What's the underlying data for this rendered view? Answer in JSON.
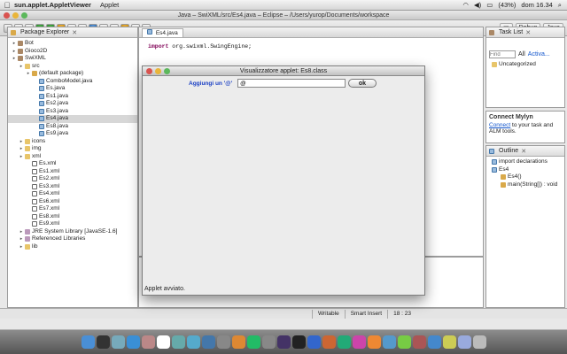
{
  "menubar": {
    "app_name": "sun.applet.AppletViewer",
    "menu": "Applet",
    "battery": "(43%)",
    "clock": "dom 16.34"
  },
  "eclipse": {
    "title": "Java – SwiXML/src/Es4.java – Eclipse – /Users/yurop/Documents/workspace",
    "perspectives": [
      "Debug",
      "Java"
    ]
  },
  "package_explorer": {
    "title": "Package Explorer",
    "items": [
      {
        "label": "Bot",
        "level": 0,
        "icon": "project-icon"
      },
      {
        "label": "Gioco2D",
        "level": 0,
        "icon": "project-icon"
      },
      {
        "label": "SwiXML",
        "level": 0,
        "icon": "project-icon"
      },
      {
        "label": "src",
        "level": 1,
        "icon": "folder-icon"
      },
      {
        "label": "(default package)",
        "level": 2,
        "icon": "package-icon"
      },
      {
        "label": "ComboModel.java",
        "level": 3,
        "icon": "java-file-icon"
      },
      {
        "label": "Es.java",
        "level": 3,
        "icon": "java-file-icon"
      },
      {
        "label": "Es1.java",
        "level": 3,
        "icon": "java-file-icon"
      },
      {
        "label": "Es2.java",
        "level": 3,
        "icon": "java-file-icon"
      },
      {
        "label": "Es3.java",
        "level": 3,
        "icon": "java-file-icon"
      },
      {
        "label": "Es4.java",
        "level": 3,
        "icon": "java-file-icon",
        "selected": true
      },
      {
        "label": "Es8.java",
        "level": 3,
        "icon": "java-file-icon"
      },
      {
        "label": "Es9.java",
        "level": 3,
        "icon": "java-file-icon"
      },
      {
        "label": "icons",
        "level": 1,
        "icon": "folder-icon"
      },
      {
        "label": "img",
        "level": 1,
        "icon": "folder-icon"
      },
      {
        "label": "xml",
        "level": 1,
        "icon": "folder-icon"
      },
      {
        "label": "Es.xml",
        "level": 2,
        "icon": "xml-file-icon"
      },
      {
        "label": "Es1.xml",
        "level": 2,
        "icon": "xml-file-icon"
      },
      {
        "label": "Es2.xml",
        "level": 2,
        "icon": "xml-file-icon"
      },
      {
        "label": "Es3.xml",
        "level": 2,
        "icon": "xml-file-icon"
      },
      {
        "label": "Es4.xml",
        "level": 2,
        "icon": "xml-file-icon"
      },
      {
        "label": "Es6.xml",
        "level": 2,
        "icon": "xml-file-icon"
      },
      {
        "label": "Es7.xml",
        "level": 2,
        "icon": "xml-file-icon"
      },
      {
        "label": "Es8.xml",
        "level": 2,
        "icon": "xml-file-icon"
      },
      {
        "label": "Es9.xml",
        "level": 2,
        "icon": "xml-file-icon"
      },
      {
        "label": "JRE System Library [JavaSE-1.6]",
        "level": 1,
        "icon": "library-icon"
      },
      {
        "label": "Referenced Libraries",
        "level": 1,
        "icon": "library-icon"
      },
      {
        "label": "lib",
        "level": 1,
        "icon": "folder-icon"
      }
    ]
  },
  "editor": {
    "tab": "Es4.java",
    "code_keyword": "import",
    "code_rest": " org.swixml.SwingEngine;"
  },
  "task_list": {
    "title": "Task List",
    "find_placeholder": "Find",
    "filter_all": "All",
    "activate": "Activa...",
    "category": "Uncategorized"
  },
  "mylyn": {
    "title": "Connect Mylyn",
    "link": "Connect",
    "text": " to your task and ALM tools."
  },
  "outline": {
    "title": "Outline",
    "items": [
      {
        "label": "import declarations",
        "level": 0
      },
      {
        "label": "Es4",
        "level": 0
      },
      {
        "label": "Es4()",
        "level": 1
      },
      {
        "label": "main(String[]) : void",
        "level": 1
      }
    ]
  },
  "statusbar": {
    "writable": "Writable",
    "insert_mode": "Smart Insert",
    "position": "18 : 23"
  },
  "applet": {
    "title": "Visualizzatore applet: Es8.class",
    "field_label": "Aggiungi un '@'",
    "field_value": "@",
    "ok_label": "ok",
    "status": "Applet avviato."
  },
  "dock": {
    "items": [
      "finder-icon",
      "dashboard-icon",
      "mail-icon",
      "safari-icon",
      "address-book-icon",
      "calendar-icon",
      "preview-icon",
      "itunes-icon",
      "iphoto-icon",
      "imovie-icon",
      "garageband-icon",
      "time-machine-icon",
      "system-preferences-icon",
      "eclipse-icon",
      "terminal-icon",
      "word-icon",
      "powerpoint-icon",
      "excel-icon",
      "app-icon",
      "app-icon",
      "app-icon",
      "app-icon",
      "app-icon",
      "app-icon",
      "app-icon",
      "downloads-icon",
      "trash-icon"
    ],
    "colors": [
      "#4a8fd6",
      "#333",
      "#7ab",
      "#3a8fd6",
      "#b88",
      "#fff",
      "#6aa",
      "#5ac",
      "#47a",
      "#888",
      "#d83",
      "#2b6",
      "#888",
      "#436",
      "#222",
      "#3366cc",
      "#c63",
      "#2a7",
      "#c4a",
      "#e83",
      "#59c",
      "#7c4",
      "#a55",
      "#48c",
      "#cc5",
      "#9ad",
      "#bbb"
    ]
  }
}
